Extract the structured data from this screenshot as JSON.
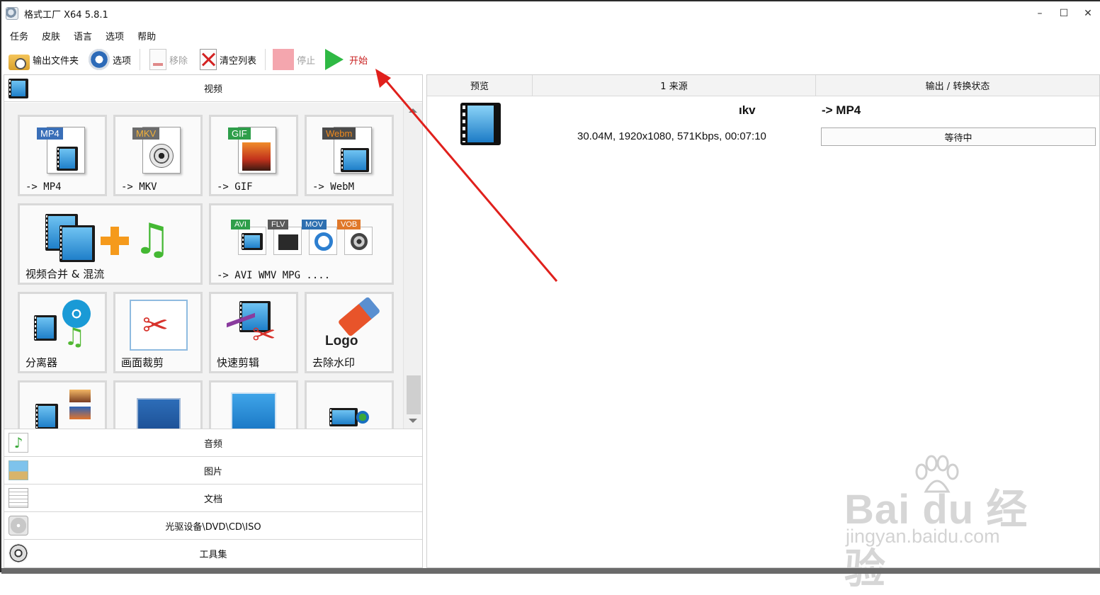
{
  "window": {
    "title": "格式工厂 X64 5.8.1",
    "controls": {
      "minimize": "–",
      "maximize": "☐",
      "close": "✕"
    }
  },
  "menu": [
    "任务",
    "皮肤",
    "语言",
    "选项",
    "帮助"
  ],
  "toolbar": {
    "output_folder": "输出文件夹",
    "options": "选项",
    "remove": "移除",
    "clear_list": "清空列表",
    "stop": "停止",
    "start": "开始"
  },
  "left_panel": {
    "video_category": "视频",
    "tiles": [
      {
        "label": "-> MP4",
        "badge": "MP4",
        "badge_color": "#3a6fb8"
      },
      {
        "label": "-> MKV",
        "badge": "MKV",
        "badge_color": "#6b6b6b"
      },
      {
        "label": "-> GIF",
        "badge": "GIF",
        "badge_color": "#2e9e4a"
      },
      {
        "label": "-> WebM",
        "badge": "Webm",
        "badge_color": "#f08a1c"
      },
      {
        "label": "视频合并 & 混流"
      },
      {
        "label": "-> AVI WMV MPG ....",
        "badges": [
          "AVI",
          "FLV",
          "MOV",
          "VOB"
        ]
      },
      {
        "label": "分离器"
      },
      {
        "label": "画面裁剪"
      },
      {
        "label": "快速剪辑"
      },
      {
        "label": "去除水印",
        "logo_text": "Logo"
      }
    ],
    "bottom_categories": [
      "音频",
      "图片",
      "文档",
      "光驱设备\\DVD\\CD\\ISO",
      "工具集"
    ]
  },
  "right_panel": {
    "columns": [
      "预览",
      "1 来源",
      "输出 / 转换状态"
    ],
    "row": {
      "source_name": "ıkv",
      "source_info": "30.04M, 1920x1080, 571Kbps, 00:07:10",
      "output_format": "-> MP4",
      "status": "等待中"
    }
  },
  "watermark": {
    "brand": "Bai  du 经验",
    "sub": "jingyan.baidu.com"
  },
  "colors": {
    "annotation_arrow": "#e0201c",
    "start_label": "#c81e1e",
    "stop_icon": "#f4a6ae",
    "start_icon": "#2fb944"
  }
}
